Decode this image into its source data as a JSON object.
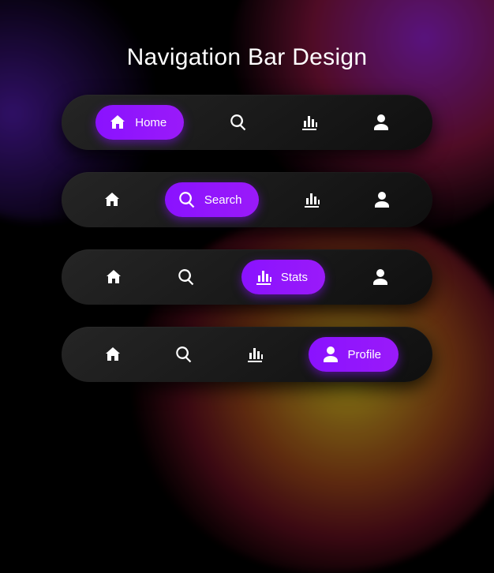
{
  "title": "Navigation Bar Design",
  "accent_color": "#8a12ff",
  "nav_items": [
    {
      "key": "home",
      "label": "Home",
      "icon": "home-icon"
    },
    {
      "key": "search",
      "label": "Search",
      "icon": "search-icon"
    },
    {
      "key": "stats",
      "label": "Stats",
      "icon": "stats-icon"
    },
    {
      "key": "profile",
      "label": "Profile",
      "icon": "profile-icon"
    }
  ],
  "bars": [
    {
      "active_index": 0
    },
    {
      "active_index": 1
    },
    {
      "active_index": 2
    },
    {
      "active_index": 3
    }
  ]
}
